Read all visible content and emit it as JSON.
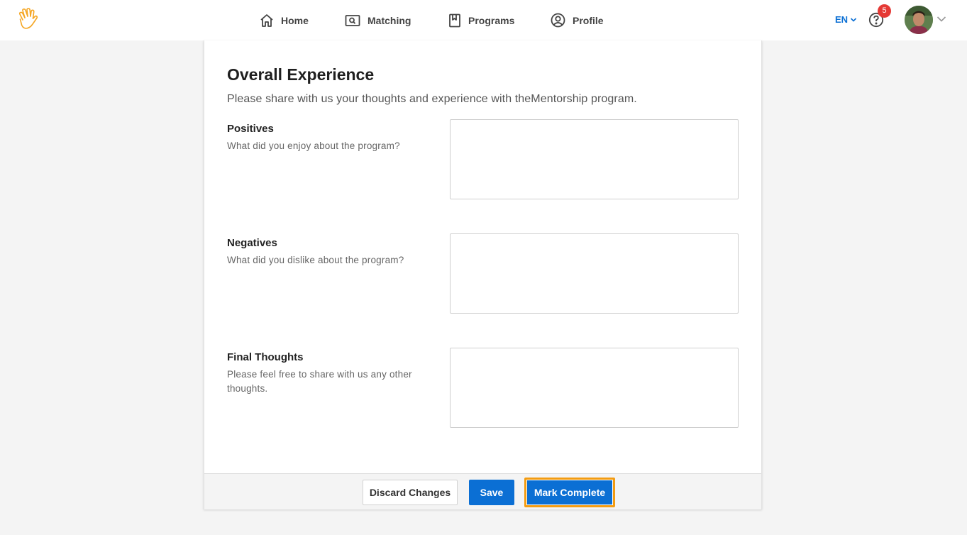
{
  "nav": {
    "home": "Home",
    "matching": "Matching",
    "programs": "Programs",
    "profile": "Profile"
  },
  "header": {
    "language": "EN",
    "help_badge_count": "5"
  },
  "form": {
    "title": "Overall Experience",
    "description": "Please share with us your thoughts and experience with theMentorship program.",
    "questions": [
      {
        "label": "Positives",
        "help": "What did you enjoy about the program?",
        "value": ""
      },
      {
        "label": "Negatives",
        "help": "What did you dislike about the program?",
        "value": ""
      },
      {
        "label": "Final Thoughts",
        "help": "Please feel free to share with us any other thoughts.",
        "value": ""
      }
    ]
  },
  "footer": {
    "discard_label": "Discard Changes",
    "save_label": "Save",
    "complete_label": "Mark Complete"
  },
  "colors": {
    "accent": "#0b6fd4",
    "focus_outline": "#f39c12",
    "badge": "#e53935",
    "logo": "#f5a623"
  },
  "icons": [
    "hand-logo-icon",
    "home-icon",
    "matching-icon",
    "bookmark-icon",
    "user-circle-icon",
    "chevron-down-icon",
    "help-icon"
  ]
}
